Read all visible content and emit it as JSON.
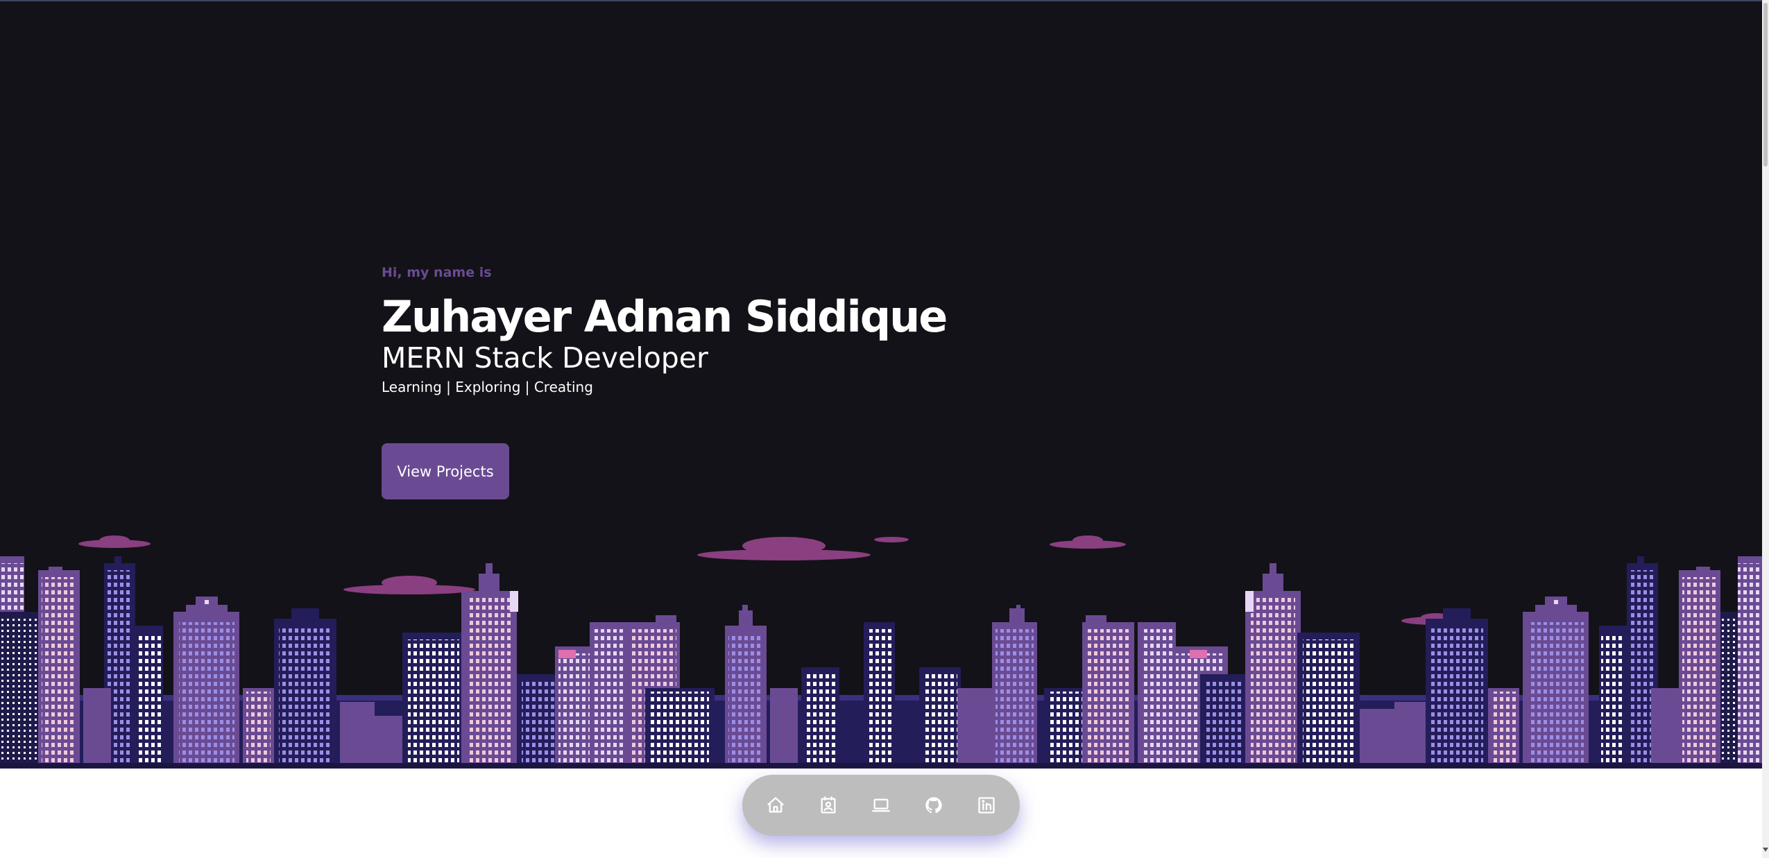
{
  "hero": {
    "greeting": "Hi, my name is",
    "name": "Zuhayer Adnan Siddique",
    "role": "MERN Stack Developer",
    "tagline": "Learning | Exploring | Creating",
    "cta_label": "View Projects"
  },
  "dock": {
    "items": [
      {
        "icon": "home-icon"
      },
      {
        "icon": "contact-card-icon"
      },
      {
        "icon": "laptop-icon"
      },
      {
        "icon": "github-icon"
      },
      {
        "icon": "linkedin-icon"
      }
    ]
  },
  "colors": {
    "background_dark": "#131218",
    "accent_purple": "#6a4b93",
    "building_light": "#6a4b93",
    "building_dark": "#231d5a",
    "cloud_pink": "#8a3f80",
    "dock_gray": "#bdbdbd",
    "dock_glow": "#7c78d4"
  }
}
